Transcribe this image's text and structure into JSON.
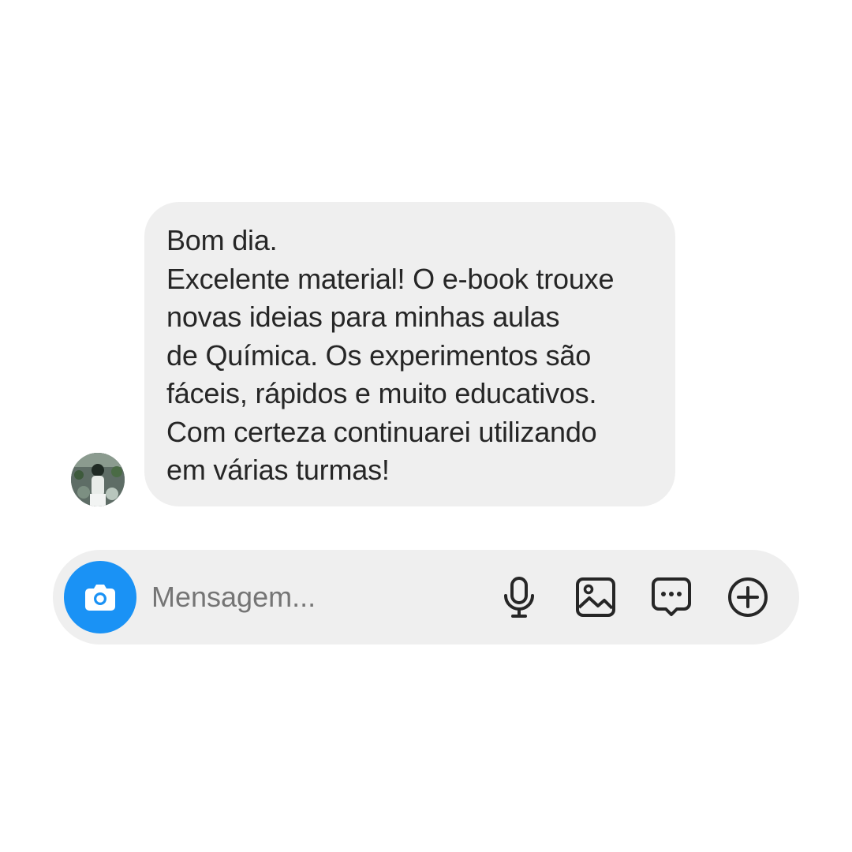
{
  "conversation": {
    "message": {
      "lines": [
        "Bom dia.",
        "Excelente material! O e-book trouxe",
        "novas ideias para minhas aulas",
        "de Química. Os experimentos são",
        "fáceis, rápidos e muito educativos.",
        "Com certeza continuarei utilizando",
        "em várias turmas!"
      ],
      "avatar_icon": "profile-photo"
    }
  },
  "composer": {
    "placeholder": "Mensagem...",
    "camera_icon": "camera-icon",
    "tools": [
      {
        "name": "microphone-icon"
      },
      {
        "name": "gallery-icon"
      },
      {
        "name": "sticker-icon"
      },
      {
        "name": "plus-icon"
      }
    ]
  },
  "colors": {
    "bubble_background": "#efefef",
    "composer_background": "#efefef",
    "camera_button": "#1a92f5",
    "text_primary": "#262626",
    "placeholder_text": "#737373"
  }
}
